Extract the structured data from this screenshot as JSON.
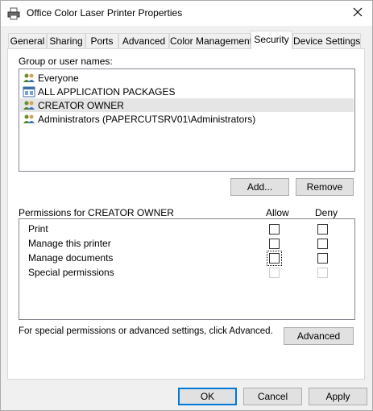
{
  "window": {
    "title": "Office Color Laser Printer Properties",
    "icon": "printer-icon"
  },
  "tabs": [
    {
      "label": "General",
      "active": false
    },
    {
      "label": "Sharing",
      "active": false
    },
    {
      "label": "Ports",
      "active": false
    },
    {
      "label": "Advanced",
      "active": false
    },
    {
      "label": "Color Management",
      "active": false
    },
    {
      "label": "Security",
      "active": true
    },
    {
      "label": "Device Settings",
      "active": false
    }
  ],
  "security": {
    "group_label": "Group or user names:",
    "users": [
      {
        "name": "Everyone",
        "icon": "users-group-icon",
        "selected": false
      },
      {
        "name": "ALL APPLICATION PACKAGES",
        "icon": "app-packages-icon",
        "selected": false
      },
      {
        "name": "CREATOR OWNER",
        "icon": "users-group-icon",
        "selected": true
      },
      {
        "name": "Administrators (PAPERCUTSRV01\\Administrators)",
        "icon": "users-group-icon",
        "selected": false
      }
    ],
    "add_label": "Add...",
    "remove_label": "Remove",
    "permissions_label": "Permissions for CREATOR OWNER",
    "allow_header": "Allow",
    "deny_header": "Deny",
    "permissions": [
      {
        "name": "Print",
        "allow": false,
        "deny": false,
        "disabled": false
      },
      {
        "name": "Manage this printer",
        "allow": false,
        "deny": false,
        "disabled": false
      },
      {
        "name": "Manage documents",
        "allow": false,
        "deny": false,
        "disabled": false,
        "focused": true
      },
      {
        "name": "Special permissions",
        "allow": false,
        "deny": false,
        "disabled": true
      }
    ],
    "advanced_hint": "For special permissions or advanced settings, click Advanced.",
    "advanced_label": "Advanced"
  },
  "footer": {
    "ok_label": "OK",
    "cancel_label": "Cancel",
    "apply_label": "Apply"
  },
  "colors": {
    "accent": "#0078d7",
    "selection": "#e5e5e5"
  }
}
